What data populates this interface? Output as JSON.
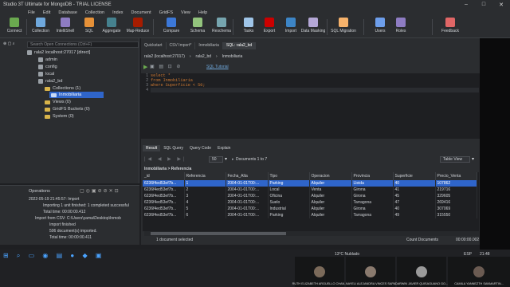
{
  "window": {
    "title": "Studio 3T Ultimate for MongoDB - TRIAL LICENSE"
  },
  "menu": [
    "File",
    "Edit",
    "Database",
    "Collection",
    "Index",
    "Document",
    "GridFS",
    "View",
    "Help"
  ],
  "toolbar": [
    {
      "label": "Connect",
      "icon": "plug-icon",
      "color": "#6aa84f"
    },
    {
      "label": "Collection",
      "icon": "collection-icon",
      "color": "#6fa8dc"
    },
    {
      "label": "IntelliShell",
      "icon": "shell-icon",
      "color": "#8e7cc3"
    },
    {
      "label": "SQL",
      "icon": "sql-icon",
      "color": "#e69138"
    },
    {
      "label": "Aggregate",
      "icon": "aggregate-icon",
      "color": "#45818e"
    },
    {
      "label": "Map-Reduce",
      "icon": "map-reduce-icon",
      "color": "#a61c00"
    },
    {
      "label": "Compare",
      "icon": "compare-icon",
      "color": "#3c78d8"
    },
    {
      "label": "Schema",
      "icon": "schema-icon",
      "color": "#93c47d"
    },
    {
      "label": "Reschema",
      "icon": "reschema-icon",
      "color": "#76a5af"
    },
    {
      "label": "Tasks",
      "icon": "tasks-icon",
      "color": "#9fc5e8"
    },
    {
      "label": "Export",
      "icon": "export-icon",
      "color": "#cc0000"
    },
    {
      "label": "Import",
      "icon": "import-icon",
      "color": "#3d85c6"
    },
    {
      "label": "Data Masking",
      "icon": "data-masking-icon",
      "color": "#b4a7d6"
    },
    {
      "label": "SQL Migration",
      "icon": "sql-migration-icon",
      "color": "#f6b26b"
    },
    {
      "label": "Users",
      "icon": "users-icon",
      "color": "#6d9eeb"
    },
    {
      "label": "Roles",
      "icon": "roles-icon",
      "color": "#8e7cc3"
    },
    {
      "label": "Feedback",
      "icon": "feedback-icon",
      "color": "#e06666"
    }
  ],
  "sidebar": {
    "search_placeholder": "Search Open Connections (Ctrl+F)",
    "connection": "rala2 localhost:27017 [direct]",
    "items": [
      "admin",
      "config",
      "local",
      "rala2_bd",
      "Collections (1)",
      "Inmobiliaria",
      "Views (0)",
      "GridFS Buckets (0)",
      "System (0)"
    ]
  },
  "operations": {
    "title": "Operations",
    "lines": [
      "2022-05-19 21:45:57:  Import",
      "Importing 1 unit finished: 1 completed successful",
      "Total time: 00:00:00.412",
      "Import from CSV: C:\\Users\\yama\\Desktop\\Inmob",
      "Import finished",
      "506 document(s) imported.",
      "Total time: 00:00:00.411"
    ]
  },
  "tabs": [
    "Quickstart",
    "CSV Import*",
    "Inmobiliaria",
    "SQL: rala2_bd"
  ],
  "breadcrumb": [
    "rala2 (localhost:27017)",
    "rala2_bd",
    "Inmobiliaria"
  ],
  "sql_tutorial": "SQL Tutorial",
  "editor": {
    "lines": [
      "select *",
      "from Inmobiliaria",
      "where Superficie < 50;",
      ""
    ]
  },
  "result_tabs": [
    "Result",
    "SQL Query",
    "Query Code",
    "Explain"
  ],
  "pager": {
    "size": "50",
    "info": "Documents 1 to 7",
    "view": "Table View"
  },
  "grid_path": "Inmobiliaria > Referencia",
  "columns": [
    "_id",
    "Referencia",
    "Fecha_Alta",
    "Tipo",
    "Operacion",
    "Provincia",
    "Superficie",
    "Precio_Venta"
  ],
  "rows": [
    [
      "6236f4ed53ef7b...",
      "1",
      "2004-01-01T00:...",
      "Parking",
      "Alquiler",
      "Lleida",
      "40",
      "107862"
    ],
    [
      "6236f4ed53ef7b...",
      "2",
      "2004-01-01T00:...",
      "Local",
      "Venta",
      "Girona",
      "41",
      "219716"
    ],
    [
      "6236f4ed53ef7b...",
      "3",
      "2004-01-01T00:...",
      "Oficina",
      "Alquiler",
      "Girona",
      "45",
      "329605"
    ],
    [
      "6236f4ed53ef7b...",
      "4",
      "2004-01-01T00:...",
      "Suelo",
      "Alquiler",
      "Tarragona",
      "47",
      "269416"
    ],
    [
      "6236f4ed53ef7b...",
      "5",
      "2004-01-01T00:...",
      "Industrial",
      "Alquiler",
      "Girona",
      "40",
      "307069"
    ],
    [
      "6236f4ed53ef7b...",
      "6",
      "2004-01-01T00:...",
      "Parking",
      "Alquiler",
      "Tarragona",
      "49",
      "315550"
    ]
  ],
  "status": {
    "selected": "1 document selected",
    "count": "Count Documents",
    "time": "00:00:00.002"
  },
  "taskbar": {
    "weather": "13°C  Nublado",
    "lang": "ESP",
    "time": "21:48"
  },
  "participants": [
    "RUTH ELIZABETH ARGUELLO CHAN...",
    "NAYELI ALEJANDRA VINCES SAPA",
    "DARWIN JAVIER QUISAGUANO GO...",
    "CAMILA YANNEZTH SANMARTIN..."
  ]
}
